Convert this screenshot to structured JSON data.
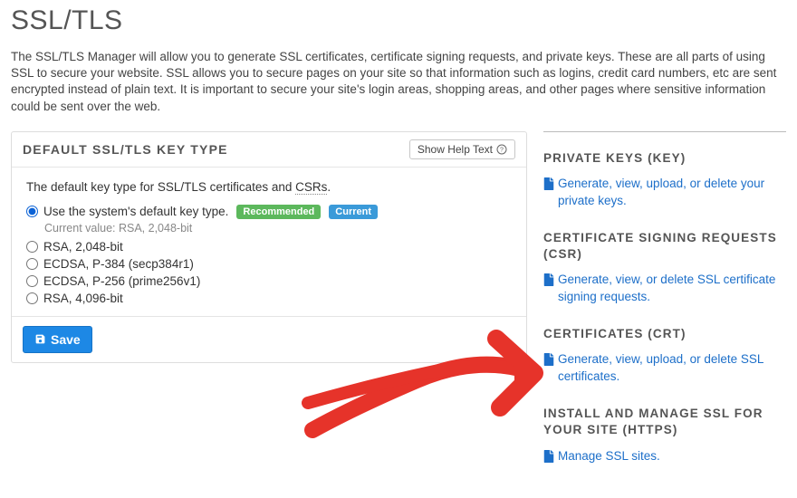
{
  "page_title": "SSL/TLS",
  "intro": "The SSL/TLS Manager will allow you to generate SSL certificates, certificate signing requests, and private keys. These are all parts of using SSL to secure your website. SSL allows you to secure pages on your site so that information such as logins, credit card numbers, etc are sent encrypted instead of plain text. It is important to secure your site's login areas, shopping areas, and other pages where sensitive information could be sent over the web.",
  "panel": {
    "title": "DEFAULT SSL/TLS KEY TYPE",
    "help_btn": "Show Help Text",
    "lead_prefix": "The default key type for SSL/TLS certificates and ",
    "lead_csrs": "CSRs",
    "lead_suffix": ".",
    "badge_rec": "Recommended",
    "badge_cur": "Current",
    "current_value_label": "Current value: RSA, 2,048-bit",
    "options": [
      {
        "label": "Use the system's default key type.",
        "checked": true,
        "rec": true,
        "cur": true
      },
      {
        "label": "RSA, 2,048-bit",
        "checked": false,
        "rec": false,
        "cur": false
      },
      {
        "label": "ECDSA, P-384 (secp384r1)",
        "checked": false,
        "rec": false,
        "cur": false
      },
      {
        "label": "ECDSA, P-256 (prime256v1)",
        "checked": false,
        "rec": false,
        "cur": false
      },
      {
        "label": "RSA, 4,096-bit",
        "checked": false,
        "rec": false,
        "cur": false
      }
    ],
    "save_label": "Save"
  },
  "sidebar": [
    {
      "title": "PRIVATE KEYS (KEY)",
      "link": "Generate, view, upload, or delete your private keys."
    },
    {
      "title": "CERTIFICATE SIGNING REQUESTS (CSR)",
      "link": "Generate, view, or delete SSL certificate signing requests."
    },
    {
      "title": "CERTIFICATES (CRT)",
      "link": "Generate, view, upload, or delete SSL certificates."
    },
    {
      "title": "INSTALL AND MANAGE SSL FOR YOUR SITE (HTTPS)",
      "link": "Manage SSL sites."
    }
  ]
}
